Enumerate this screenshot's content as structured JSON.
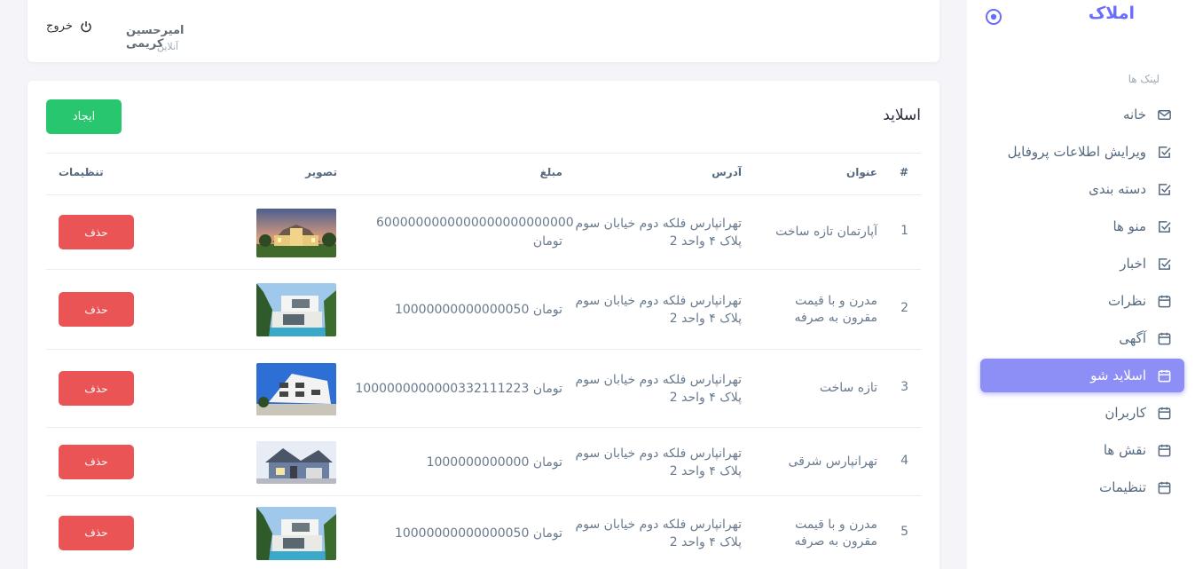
{
  "sidebar": {
    "brand": "املاک",
    "links_heading": "لینک ها",
    "items": [
      {
        "label": "خانه",
        "icon": "mail-icon",
        "active": false
      },
      {
        "label": "ویرایش اطلاعات پروفایل",
        "icon": "checkbox-icon",
        "active": false
      },
      {
        "label": "دسته بندی",
        "icon": "checkbox-icon",
        "active": false
      },
      {
        "label": "منو ها",
        "icon": "checkbox-icon",
        "active": false
      },
      {
        "label": "اخبار",
        "icon": "checkbox-icon",
        "active": false
      },
      {
        "label": "نظرات",
        "icon": "calendar-icon",
        "active": false
      },
      {
        "label": "آگهی",
        "icon": "calendar-icon",
        "active": false
      },
      {
        "label": "اسلاید شو",
        "icon": "calendar-icon",
        "active": true
      },
      {
        "label": "کاربران",
        "icon": "calendar-icon",
        "active": false
      },
      {
        "label": "نقش ها",
        "icon": "calendar-icon",
        "active": false
      },
      {
        "label": "تنظیمات",
        "icon": "calendar-icon",
        "active": false
      }
    ]
  },
  "header": {
    "logout_label": "خروج",
    "user_name": "امیرحسین کریمی",
    "user_status": "آنلاین"
  },
  "main": {
    "title": "اسلاید",
    "create_label": "ایجاد",
    "columns": {
      "num": "#",
      "title": "عنوان",
      "address": "آدرس",
      "price": "مبلغ",
      "image": "تصویر",
      "settings": "تنظیمات"
    },
    "delete_label": "حذف",
    "rows": [
      {
        "num": "1",
        "title": "آپارتمان تازه ساخت",
        "address": "تهرانپارس فلکه دوم خیابان سوم پلاک ۴ واحد 2",
        "price": "6000000000000000000000000 تومان",
        "image": "dusk-mansion"
      },
      {
        "num": "2",
        "title": "مدرن و با قیمت مقرون به صرفه",
        "address": "تهرانپارس فلکه دوم خیابان سوم پلاک ۴ واحد 2",
        "price": "10000000000000050 تومان",
        "image": "modern-villa"
      },
      {
        "num": "3",
        "title": "تازه ساخت",
        "address": "تهرانپارس فلکه دوم خیابان سوم پلاک ۴ واحد 2",
        "price": "1000000000000332111223 تومان",
        "image": "apartment-block"
      },
      {
        "num": "4",
        "title": "تهرانپارس شرقی",
        "address": "تهرانپارس فلکه دوم خیابان سوم پلاک ۴ واحد 2",
        "price": "1000000000000 تومان",
        "image": "suburban-house"
      },
      {
        "num": "5",
        "title": "مدرن و با قیمت مقرون به صرفه",
        "address": "تهرانپارس فلکه دوم خیابان سوم پلاک ۴ واحد 2",
        "price": "10000000000000050 تومان",
        "image": "modern-villa"
      }
    ]
  }
}
